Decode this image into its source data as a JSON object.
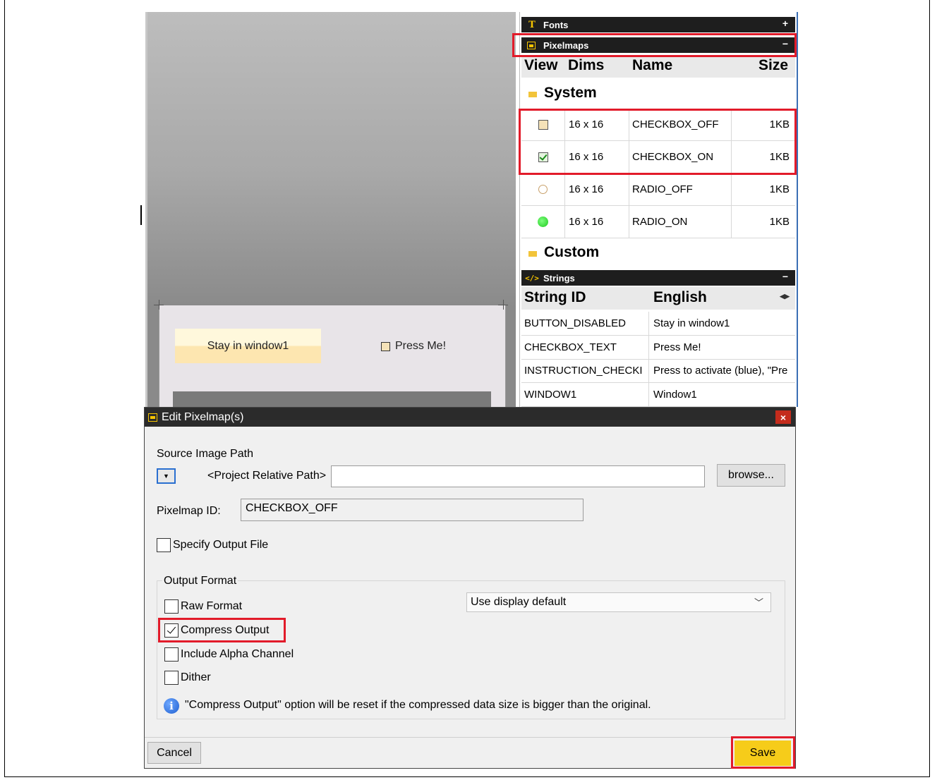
{
  "canvas": {
    "stay_button": "Stay in window1",
    "press_checkbox": "Press Me!"
  },
  "resources": {
    "fonts_header": "Fonts",
    "fonts_sign": "+",
    "pixelmaps_header": "Pixelmaps",
    "pixelmaps_sign": "−",
    "columns": [
      "View",
      "Dims",
      "Name",
      "Size"
    ],
    "folder_system": "System",
    "folder_custom": "Custom",
    "pixelmaps": [
      {
        "icon": "checkbox-off-icon",
        "dims": "16 x 16",
        "name": "CHECKBOX_OFF",
        "size": "1KB"
      },
      {
        "icon": "checkbox-on-icon",
        "dims": "16 x 16",
        "name": "CHECKBOX_ON",
        "size": "1KB"
      },
      {
        "icon": "radio-off-icon",
        "dims": "16 x 16",
        "name": "RADIO_OFF",
        "size": "1KB"
      },
      {
        "icon": "radio-on-icon",
        "dims": "16 x 16",
        "name": "RADIO_ON",
        "size": "1KB"
      }
    ],
    "strings_header": "Strings",
    "strings_sign": "−",
    "string_columns": [
      "String ID",
      "English"
    ],
    "strings": [
      {
        "id": "BUTTON_DISABLED",
        "english": "Stay in window1"
      },
      {
        "id": "CHECKBOX_TEXT",
        "english": "Press Me!"
      },
      {
        "id": "INSTRUCTION_CHECKI",
        "english": "Press to activate (blue), \"Pre"
      },
      {
        "id": "WINDOW1",
        "english": "Window1"
      }
    ]
  },
  "dialog": {
    "title": "Edit Pixelmap(s)",
    "close": "×",
    "source_image_path_label": "Source Image Path",
    "path_mode": "<Project Relative Path>",
    "path_value": "",
    "browse_label": "browse...",
    "pixelmap_id_label": "Pixelmap ID:",
    "pixelmap_id_value": "CHECKBOX_OFF",
    "specify_output_file": "Specify Output File",
    "output_format_label": "Output Format",
    "raw_format": "Raw Format",
    "compress_output": "Compress Output",
    "include_alpha": "Include Alpha Channel",
    "dither": "Dither",
    "format_select": "Use display default",
    "info_text": "\"Compress Output\" option will be reset if the compressed data size is bigger than the original.",
    "cancel_label": "Cancel",
    "save_label": "Save",
    "checks": {
      "specify_output_file": false,
      "raw_format": false,
      "compress_output": true,
      "include_alpha": false,
      "dither": false
    }
  },
  "colors": {
    "highlight": "#e21b2a",
    "save": "#f6cc1a",
    "titlebar": "#2b2b2b"
  }
}
